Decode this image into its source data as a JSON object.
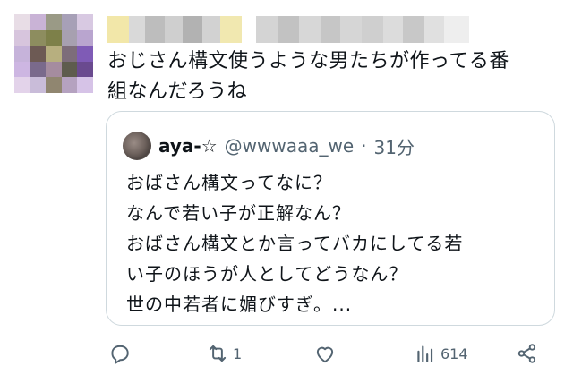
{
  "tweet": {
    "author_name_blurred": true,
    "text_lines": [
      "おじさん構文使うような男たちが作ってる番",
      "組なんだろうね"
    ]
  },
  "quoted_tweet": {
    "name": "aya-☆",
    "handle": "@wwwaaa_we",
    "separator": "·",
    "time": "31分",
    "lines": [
      "おばさん構文ってなに？",
      "なんで若い子が正解なん？",
      "おばさん構文とか言ってバカにしてる若",
      "い子のほうが人としてどうなん？",
      "世の中若者に媚びすぎ。..."
    ]
  },
  "actions": {
    "reply_icon": "reply-icon",
    "retweet_icon": "retweet-icon",
    "retweet_count": "1",
    "like_icon": "heart-icon",
    "views_icon": "views-icon",
    "views_count": "614",
    "share_icon": "share-icon"
  },
  "colors": {
    "text": "#0f1419",
    "muted": "#536471",
    "border": "#cfd9de"
  }
}
